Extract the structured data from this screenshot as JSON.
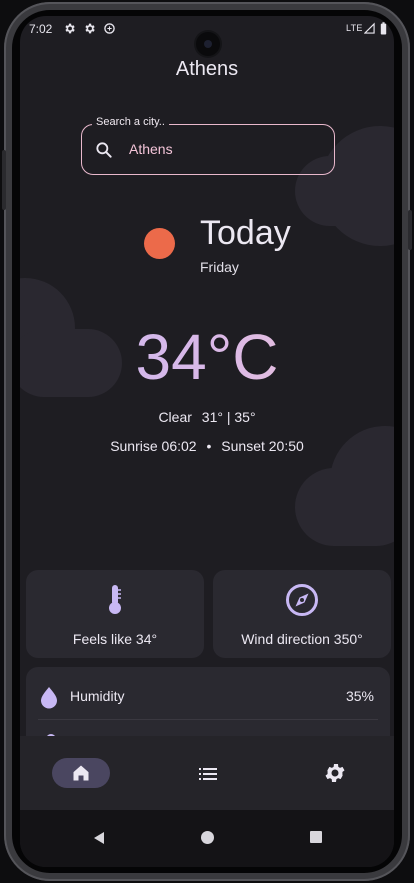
{
  "status_bar": {
    "time": "7:02",
    "network": "LTE",
    "icons": [
      "settings-icon",
      "settings-icon",
      "data-saver-icon",
      "signal-icon",
      "battery-icon"
    ]
  },
  "header": {
    "city": "Athens"
  },
  "search": {
    "label": "Search a city..",
    "value": "Athens"
  },
  "today": {
    "title": "Today",
    "weekday": "Friday",
    "sun_color": "#ec6a4a",
    "temperature": "34°C",
    "condition": "Clear",
    "min_max": "31° | 35°",
    "sunrise": "Sunrise 06:02",
    "separator": "•",
    "sunset": "Sunset 20:50"
  },
  "cards": {
    "feels_like": "Feels like 34°",
    "wind_direction": "Wind direction 350°"
  },
  "details": {
    "humidity_label": "Humidity",
    "humidity_value": "35%"
  },
  "nav": {
    "items": [
      "home-icon",
      "list-icon",
      "settings-icon"
    ],
    "active": "home"
  },
  "colors": {
    "accent": "#c8b8f4",
    "search_border": "#e8b8cc",
    "background": "#1e1d22",
    "card": "#2a2930"
  }
}
